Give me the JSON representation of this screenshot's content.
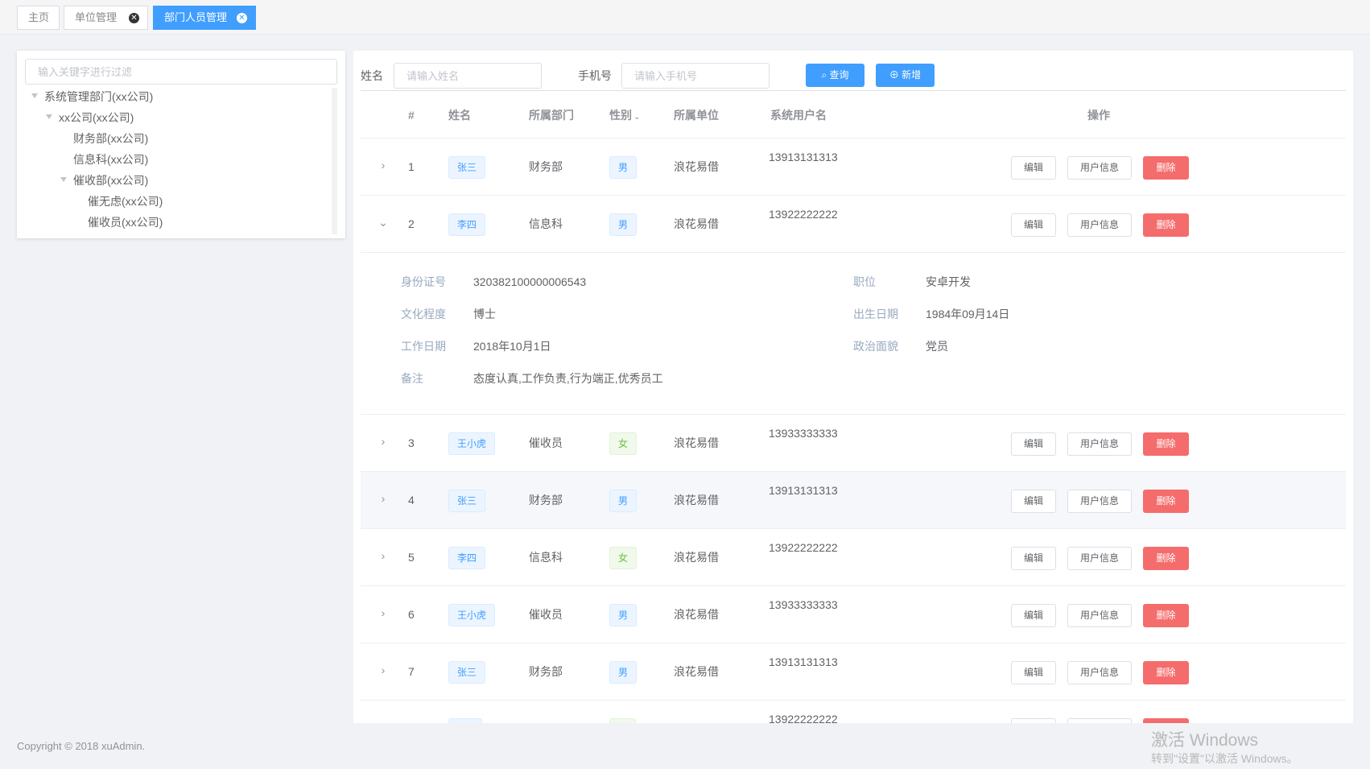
{
  "tabs": [
    {
      "label": "主页",
      "closable": false,
      "active": false
    },
    {
      "label": "单位管理",
      "closable": true,
      "active": false
    },
    {
      "label": "部门人员管理",
      "closable": true,
      "active": true
    }
  ],
  "tree": {
    "placeholder": "输入关键字进行过滤",
    "nodes": [
      {
        "label": "系统管理部门(xx公司)",
        "expanded": true
      },
      {
        "label": "xx公司(xx公司)",
        "expanded": true
      },
      {
        "label": "财务部(xx公司)"
      },
      {
        "label": "信息科(xx公司)"
      },
      {
        "label": "催收部(xx公司)",
        "expanded": true
      },
      {
        "label": "催无虑(xx公司)"
      },
      {
        "label": "催收员(xx公司)"
      }
    ]
  },
  "search": {
    "name_label": "姓名",
    "name_placeholder": "请输入姓名",
    "phone_label": "手机号",
    "phone_placeholder": "请输入手机号",
    "query_button": "查询",
    "add_button": "新增"
  },
  "table": {
    "headers": {
      "index": "#",
      "name": "姓名",
      "dept": "所属部门",
      "gender": "性别",
      "unit": "所属单位",
      "username": "系统用户名",
      "actions": "操作"
    },
    "action_labels": {
      "edit": "编辑",
      "info": "用户信息",
      "delete": "删除"
    },
    "rows": [
      {
        "index": "1",
        "name": "张三",
        "dept": "财务部",
        "gender": "男",
        "unit": "浪花易借",
        "username": "13913131313",
        "expanded": false
      },
      {
        "index": "2",
        "name": "李四",
        "dept": "信息科",
        "gender": "男",
        "unit": "浪花易借",
        "username": "13922222222",
        "expanded": true
      },
      {
        "index": "3",
        "name": "王小虎",
        "dept": "催收员",
        "gender": "女",
        "unit": "浪花易借",
        "username": "13933333333",
        "expanded": false
      },
      {
        "index": "4",
        "name": "张三",
        "dept": "财务部",
        "gender": "男",
        "unit": "浪花易借",
        "username": "13913131313",
        "expanded": false
      },
      {
        "index": "5",
        "name": "李四",
        "dept": "信息科",
        "gender": "女",
        "unit": "浪花易借",
        "username": "13922222222",
        "expanded": false
      },
      {
        "index": "6",
        "name": "王小虎",
        "dept": "催收员",
        "gender": "男",
        "unit": "浪花易借",
        "username": "13933333333",
        "expanded": false
      },
      {
        "index": "7",
        "name": "张三",
        "dept": "财务部",
        "gender": "男",
        "unit": "浪花易借",
        "username": "13913131313",
        "expanded": false
      },
      {
        "index": "8",
        "name": "",
        "dept": "",
        "gender": "",
        "unit": "",
        "username": "13922222222",
        "expanded": false
      }
    ],
    "detail": {
      "id_label": "身份证号",
      "id_value": "320382100000006543",
      "edu_label": "文化程度",
      "edu_value": "博士",
      "work_label": "工作日期",
      "work_value": "2018年10月1日",
      "note_label": "备注",
      "note_value": "态度认真,工作负责,行为端正,优秀员工",
      "pos_label": "职位",
      "pos_value": "安卓开发",
      "birth_label": "出生日期",
      "birth_value": "1984年09月14日",
      "politics_label": "政治面貌",
      "politics_value": "党员"
    }
  },
  "footer": "Copyright © 2018 xuAdmin.",
  "watermark": {
    "line1": "激活 Windows",
    "line2": "转到\"设置\"以激活 Windows。"
  }
}
